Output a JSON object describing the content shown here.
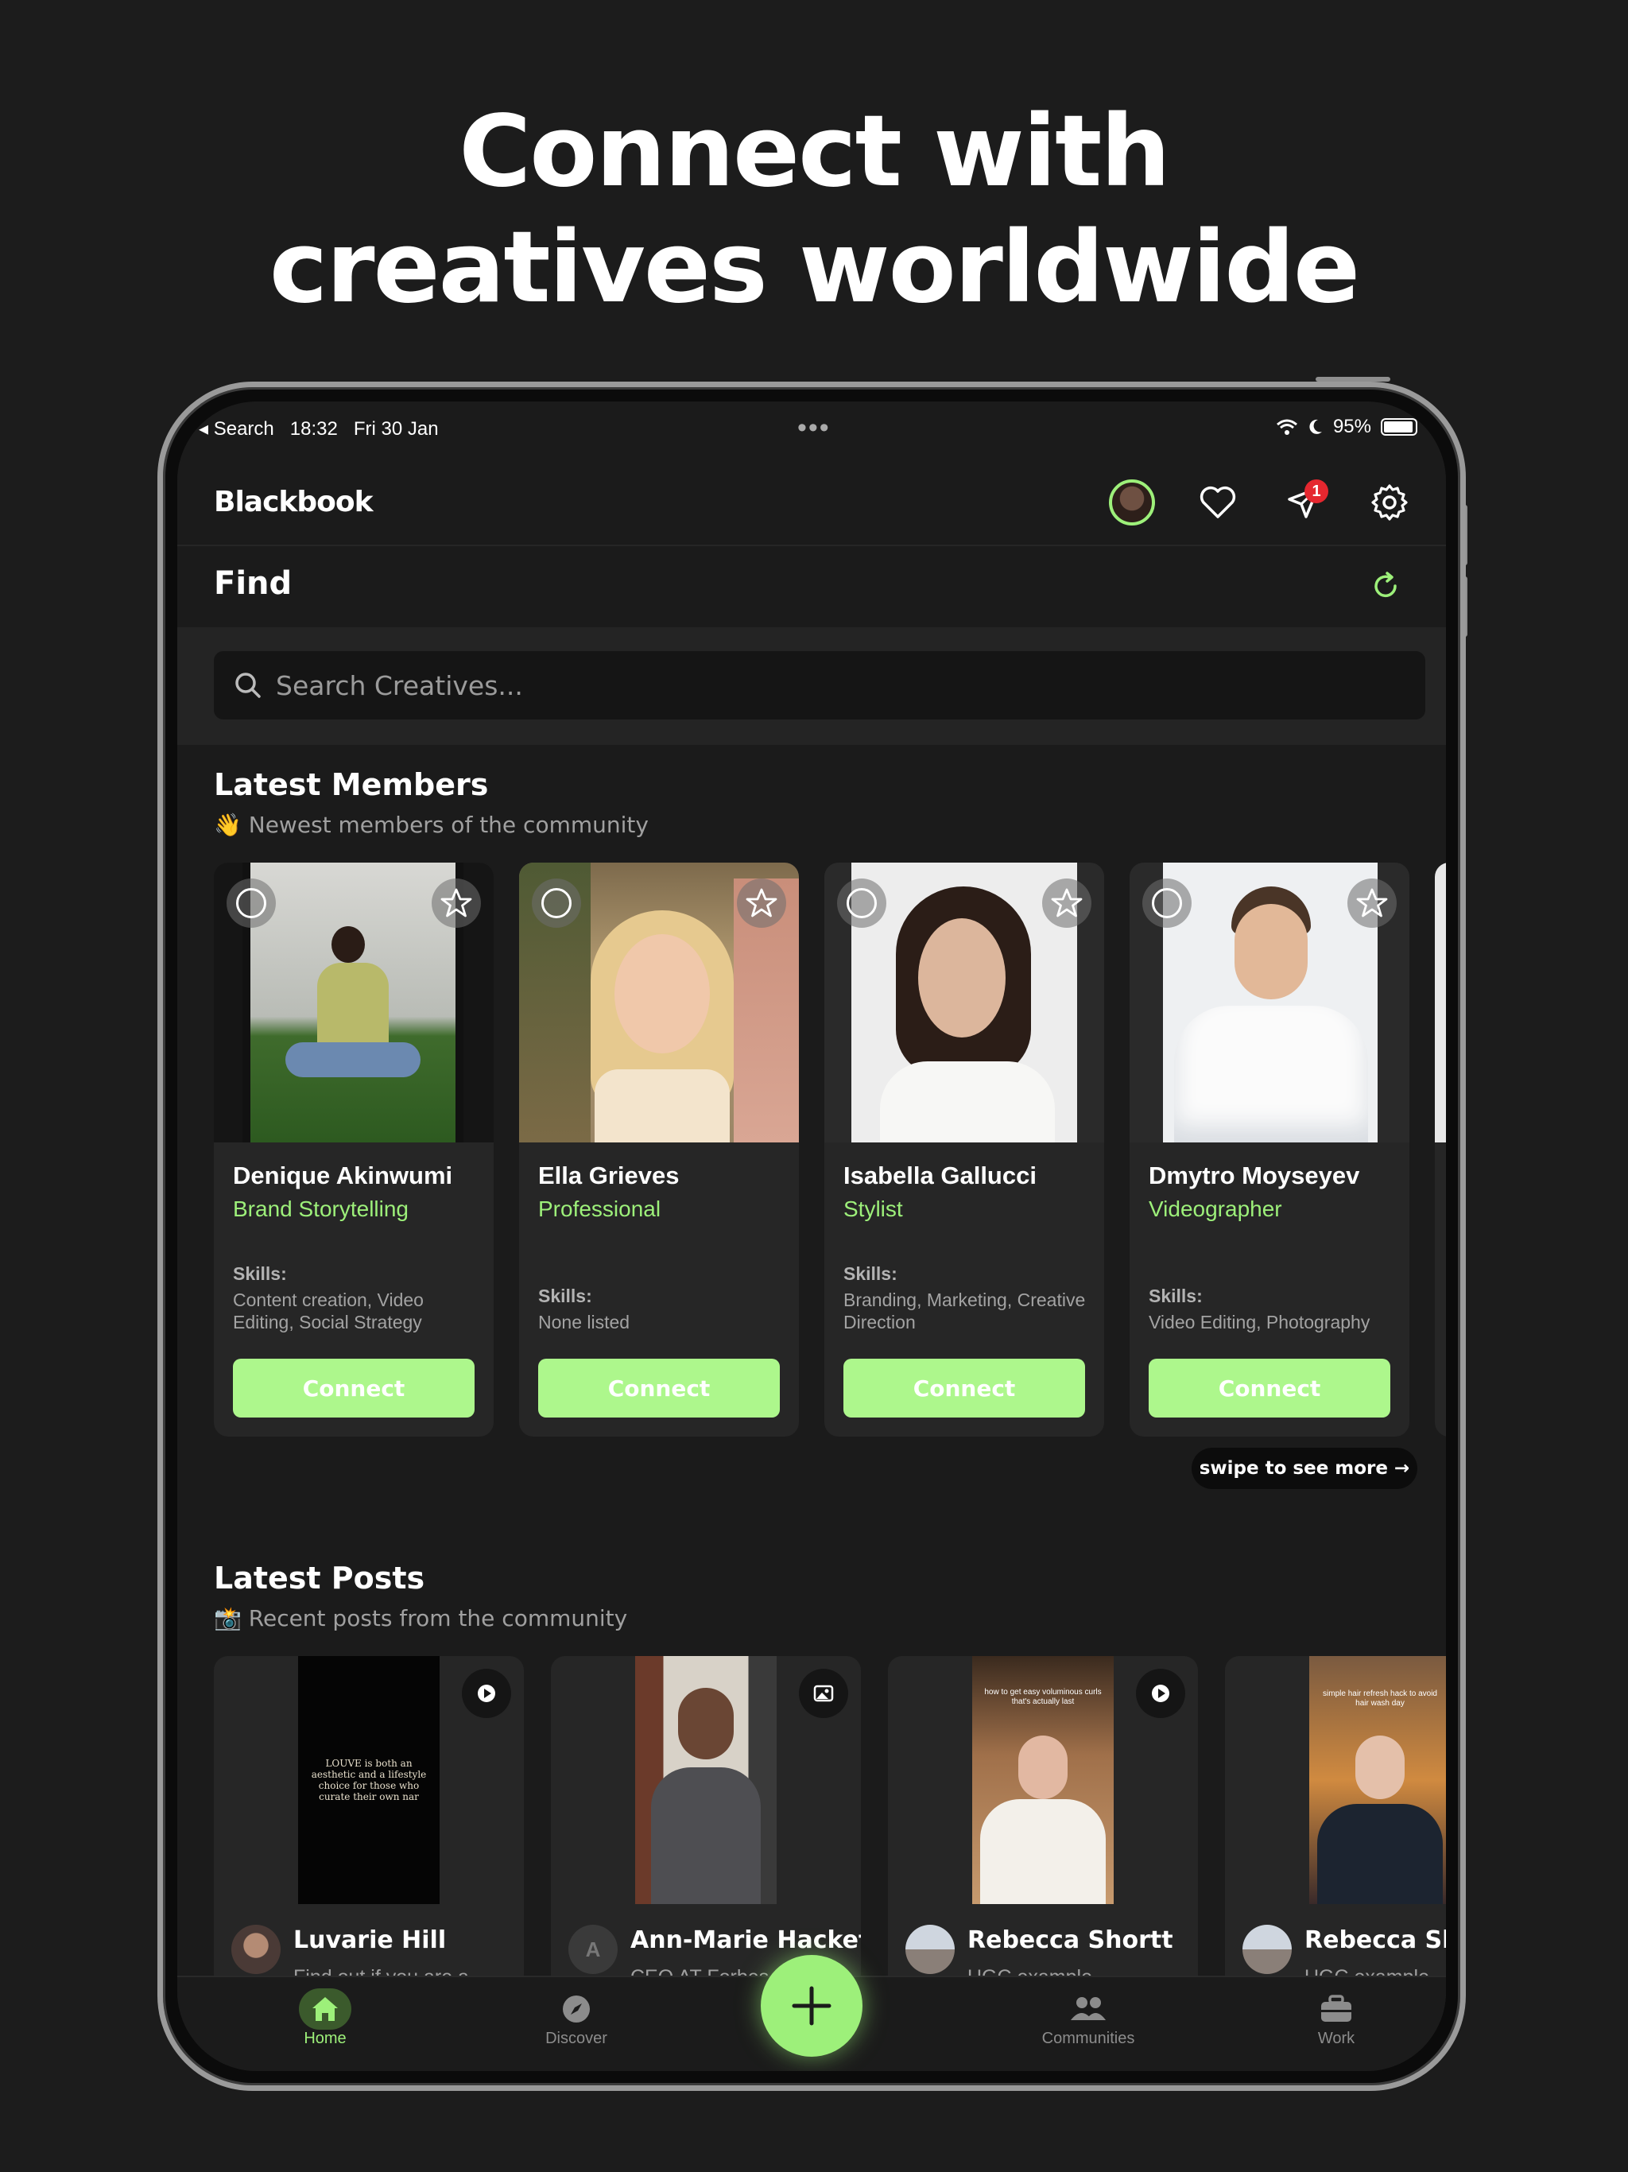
{
  "headline": {
    "line1": "Connect with",
    "line2": "creatives worldwide"
  },
  "status_bar": {
    "back_label": "Search",
    "time": "18:32",
    "date": "Fri 30 Jan",
    "battery": "95%",
    "battery_level": 0.95
  },
  "app": {
    "name": "Blackbook",
    "notification_count": "1"
  },
  "find": {
    "title": "Find",
    "search_placeholder": "Search Creatives..."
  },
  "latest_members": {
    "title": "Latest Members",
    "subtitle": "👋 Newest members of the community",
    "skills_label": "Skills:",
    "connect_label": "Connect",
    "members": [
      {
        "name": "Denique Akinwumi",
        "role": "Brand Storytelling",
        "skills": "Content creation, Video Editing, Social Strategy"
      },
      {
        "name": "Ella Grieves",
        "role": "Professional",
        "skills": "None listed"
      },
      {
        "name": "Isabella Gallucci",
        "role": "Stylist",
        "skills": "Branding, Marketing, Creative Direction"
      },
      {
        "name": "Dmytro Moyseyev",
        "role": "Videographer",
        "skills": "Video Editing, Photography"
      }
    ],
    "swipe_hint": "swipe to see more →"
  },
  "latest_posts": {
    "title": "Latest Posts",
    "subtitle": "📸 Recent posts from the community",
    "posts": [
      {
        "author": "Luvarie Hill",
        "text": "Find out if you are a",
        "type": "video-icon",
        "thumb_text": "LOUVE is both an aesthetic and a lifestyle choice for those who curate their own nar"
      },
      {
        "author": "Ann-Marie Hackett",
        "text": "CEO AT Forbes Fa",
        "type": "image-icon",
        "avatar_initial": "A"
      },
      {
        "author": "Rebecca Shortt",
        "text": "UGC example",
        "type": "video-icon",
        "thumb_text": "how to get easy voluminous curls that's actually last"
      },
      {
        "author": "Rebecca Shor",
        "text": "UGC example",
        "type": "video-icon",
        "thumb_text": "simple hair refresh hack to avoid hair wash day"
      }
    ]
  },
  "tabs": [
    {
      "label": "Home",
      "icon": "home-icon",
      "active": true
    },
    {
      "label": "Discover",
      "icon": "compass-icon"
    },
    {
      "label": "Communities",
      "icon": "people-icon"
    },
    {
      "label": "Work",
      "icon": "briefcase-icon"
    }
  ],
  "colors": {
    "accent": "#9df07a",
    "button": "#adf78c",
    "background": "#1b1b1b",
    "badge": "#e5272f"
  }
}
